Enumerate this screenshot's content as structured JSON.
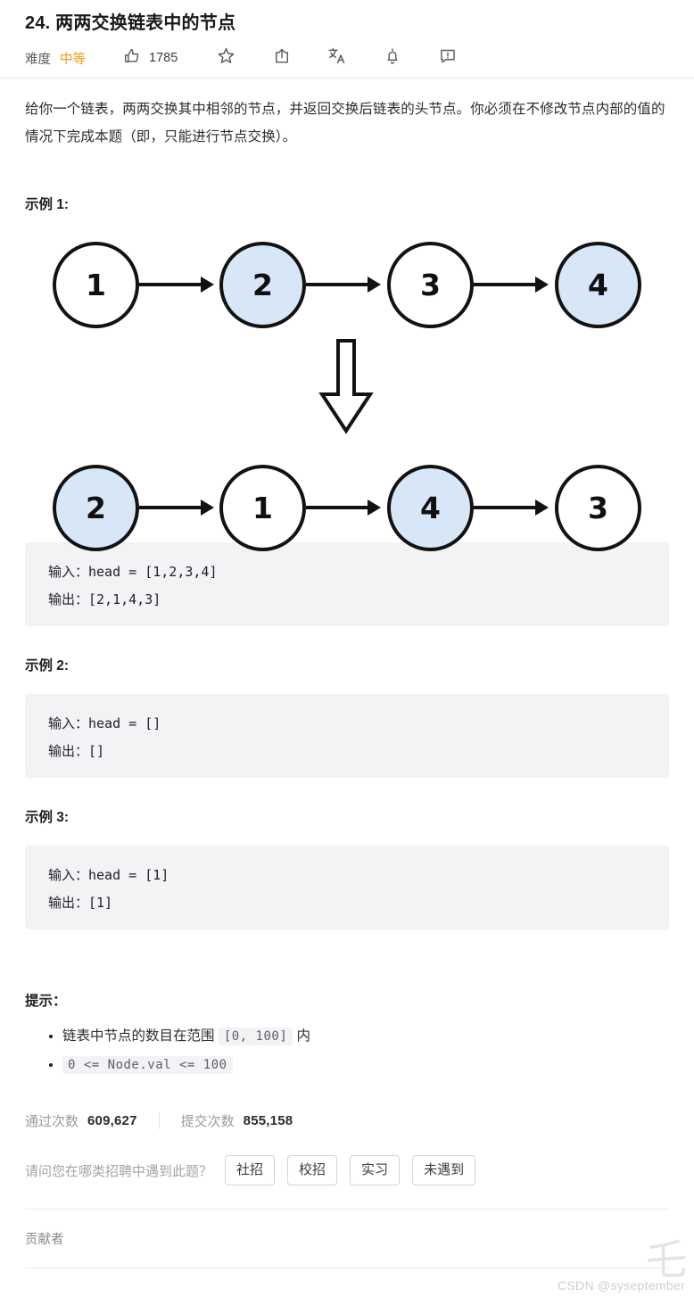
{
  "problem": {
    "title": "24. 两两交换链表中的节点",
    "difficulty_label": "难度",
    "difficulty_value": "中等",
    "like_count": "1785",
    "description": "给你一个链表，两两交换其中相邻的节点，并返回交换后链表的头节点。你必须在不修改节点内部的值的情况下完成本题（即，只能进行节点交换）。"
  },
  "icons": {
    "like": "thumbs-up-icon",
    "star": "star-icon",
    "share": "share-icon",
    "translate": "translate-icon",
    "bell": "bell-icon",
    "feedback": "feedback-icon"
  },
  "examples": [
    {
      "heading": "示例 1:",
      "code": "输入：head = [1,2,3,4]\n输出：[2,1,4,3]"
    },
    {
      "heading": "示例 2:",
      "code": "输入：head = []\n输出：[]"
    },
    {
      "heading": "示例 3:",
      "code": "输入：head = [1]\n输出：[1]"
    }
  ],
  "diagram": {
    "before": [
      {
        "value": "1",
        "highlight": false
      },
      {
        "value": "2",
        "highlight": true
      },
      {
        "value": "3",
        "highlight": false
      },
      {
        "value": "4",
        "highlight": true
      }
    ],
    "after": [
      {
        "value": "2",
        "highlight": true
      },
      {
        "value": "1",
        "highlight": false
      },
      {
        "value": "4",
        "highlight": true
      },
      {
        "value": "3",
        "highlight": false
      }
    ],
    "highlight_color": "#d7e7f8",
    "stroke_color": "#121212"
  },
  "hints": {
    "heading": "提示：",
    "items": [
      {
        "prefix": "链表中节点的数目在范围 ",
        "code": "[0, 100]",
        "suffix": " 内"
      },
      {
        "prefix": "",
        "code": "0 <= Node.val <= 100",
        "suffix": ""
      }
    ]
  },
  "stats": {
    "passed_label": "通过次数",
    "passed_value": "609,627",
    "submitted_label": "提交次数",
    "submitted_value": "855,158"
  },
  "survey": {
    "question": "请问您在哪类招聘中遇到此题？",
    "options": [
      "社招",
      "校招",
      "实习",
      "未遇到"
    ]
  },
  "footer": {
    "contributor_label": "贡献者",
    "watermark": "CSDN @syseptember"
  }
}
